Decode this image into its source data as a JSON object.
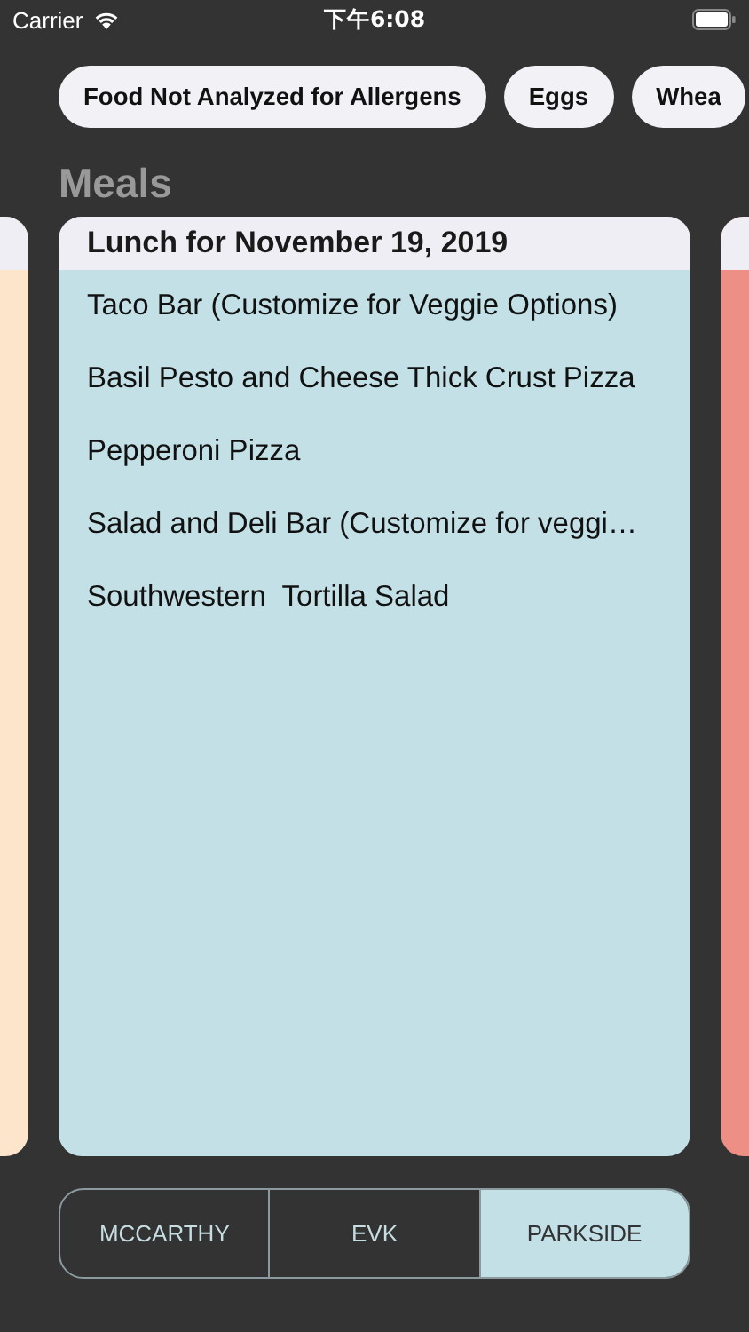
{
  "status_bar": {
    "carrier": "Carrier",
    "time": "下午6:08"
  },
  "allergen_chips": [
    "Food Not Analyzed for Allergens",
    "Eggs",
    "Whea"
  ],
  "section_title": "Meals",
  "cards": [
    {
      "color": "#fde5cc"
    },
    {
      "color": "#c3e0e6",
      "header": "Lunch for November 19, 2019",
      "items": [
        "Taco Bar (Customize for Veggie Options)",
        "Basil Pesto and Cheese Thick Crust Pizza",
        "Pepperoni Pizza",
        "Salad and Deli Bar (Customize for veggi…",
        "Southwestern  Tortilla Salad"
      ]
    },
    {
      "color": "#ee8f86"
    }
  ],
  "segments": [
    {
      "label": "MCCARTHY",
      "selected": false
    },
    {
      "label": "EVK",
      "selected": false
    },
    {
      "label": "PARKSIDE",
      "selected": true
    }
  ]
}
